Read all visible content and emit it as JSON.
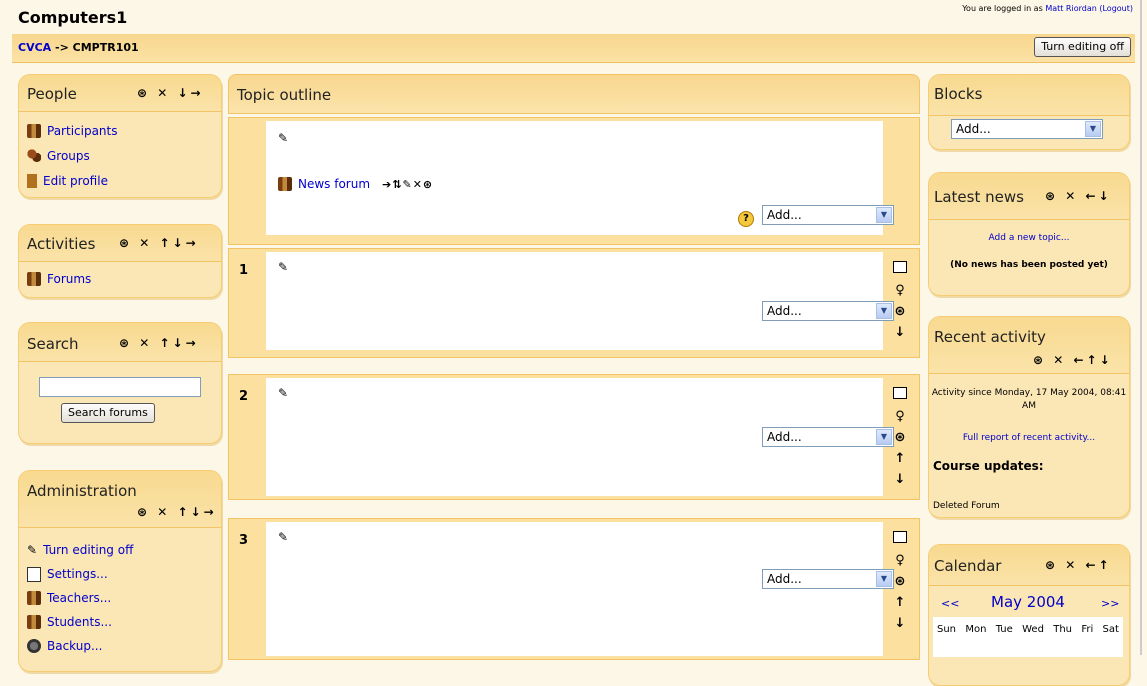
{
  "site": {
    "title": "Computers1"
  },
  "login": {
    "prefix": "You are logged in as",
    "user": "Matt Riordan",
    "logout": "(Logout)"
  },
  "nav": {
    "root": "CVCA",
    "sep": "->",
    "course": "CMPTR101",
    "edit_button": "Turn editing off"
  },
  "blocks": {
    "people": {
      "title": "People",
      "controls": "⊛ ✕ ↓→",
      "items": [
        "Participants",
        "Groups",
        "Edit profile"
      ]
    },
    "activities": {
      "title": "Activities",
      "controls": "⊛ ✕ ↑↓→",
      "items": [
        "Forums"
      ]
    },
    "search": {
      "title": "Search",
      "controls": "⊛ ✕ ↑↓→",
      "button": "Search forums",
      "value": ""
    },
    "admin": {
      "title": "Administration",
      "controls": "⊛ ✕ ↑↓→",
      "items": [
        "Turn editing off",
        "Settings...",
        "Teachers...",
        "Students...",
        "Backup..."
      ]
    },
    "add_blocks": {
      "title": "Blocks",
      "select": "Add..."
    },
    "news": {
      "title": "Latest news",
      "controls": "⊛ ✕ ←↓",
      "add": "Add a new topic...",
      "empty": "(No news has been posted yet)"
    },
    "recent": {
      "title": "Recent activity",
      "controls": "⊛ ✕ ←↑↓",
      "since": "Activity since Monday, 17 May 2004, 08:41 AM",
      "full": "Full report of recent activity...",
      "updates_heading": "Course updates:",
      "update_1": "Deleted Forum"
    },
    "calendar": {
      "title": "Calendar",
      "controls": "⊛ ✕ ←↑",
      "prev": "<<",
      "month": "May 2004",
      "next": ">>",
      "days": [
        "Sun",
        "Mon",
        "Tue",
        "Wed",
        "Thu",
        "Fri",
        "Sat"
      ]
    }
  },
  "topics": {
    "title": "Topic outline",
    "news_forum": "News forum",
    "news_ctrls": "➔⇅✎✕⊛",
    "add": "Add...",
    "sections": [
      "1",
      "2",
      "3"
    ]
  },
  "icons": [
    "edit-icon",
    "help-icon",
    "eye-icon",
    "delete-icon",
    "move-icon",
    "lightbulb-icon",
    "square-icon"
  ]
}
